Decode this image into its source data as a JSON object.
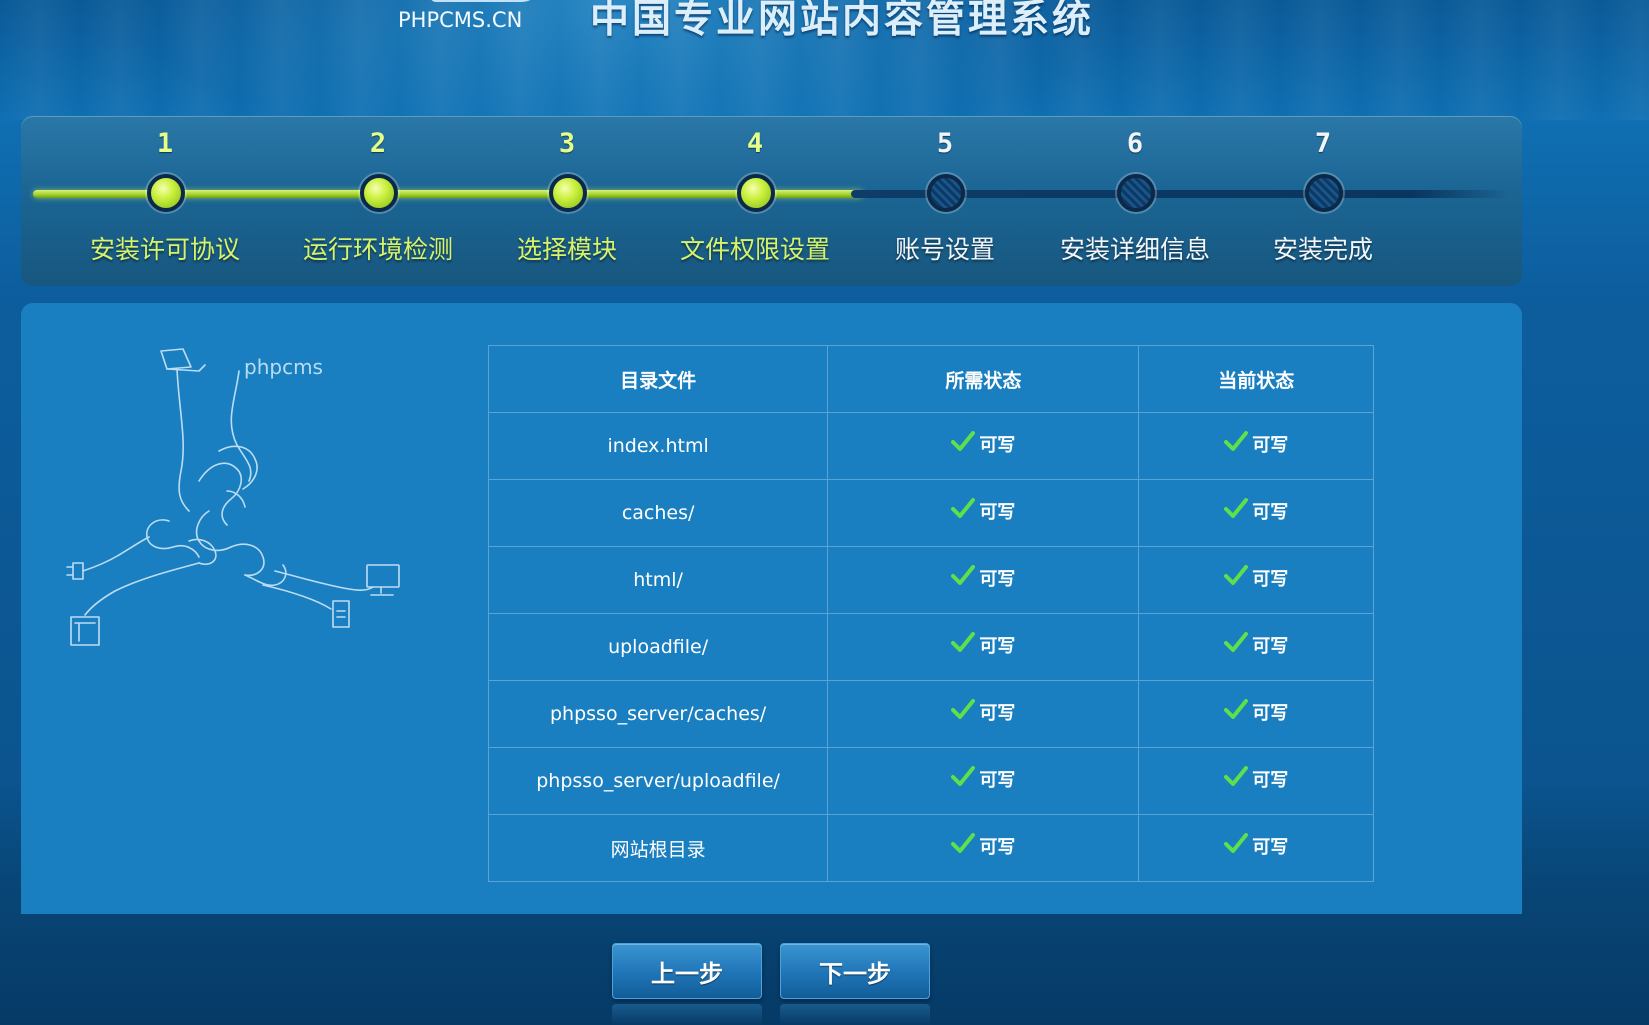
{
  "header": {
    "logo_text": "PHPCMS.CN",
    "title": "中国专业网站内容管理系统"
  },
  "steps": [
    {
      "num": "1",
      "label": "安装许可协议",
      "status": "done"
    },
    {
      "num": "2",
      "label": "运行环境检测",
      "status": "done"
    },
    {
      "num": "3",
      "label": "选择模块",
      "status": "done"
    },
    {
      "num": "4",
      "label": "文件权限设置",
      "status": "current"
    },
    {
      "num": "5",
      "label": "账号设置",
      "status": "todo"
    },
    {
      "num": "6",
      "label": "安装详细信息",
      "status": "todo"
    },
    {
      "num": "7",
      "label": "安装完成",
      "status": "todo"
    }
  ],
  "illustration": {
    "caption": "phpcms"
  },
  "permissions_table": {
    "headers": [
      "目录文件",
      "所需状态",
      "当前状态"
    ],
    "rows": [
      {
        "path": "index.html",
        "required": "可写",
        "current": "可写"
      },
      {
        "path": "caches/",
        "required": "可写",
        "current": "可写"
      },
      {
        "path": "html/",
        "required": "可写",
        "current": "可写"
      },
      {
        "path": "uploadfile/",
        "required": "可写",
        "current": "可写"
      },
      {
        "path": "phpsso_server/caches/",
        "required": "可写",
        "current": "可写"
      },
      {
        "path": "phpsso_server/uploadfile/",
        "required": "可写",
        "current": "可写"
      },
      {
        "path": "网站根目录",
        "required": "可写",
        "current": "可写"
      }
    ]
  },
  "buttons": {
    "prev_label": "上一步",
    "next_label": "下一步"
  },
  "colors": {
    "done_step": "#c9f03c",
    "todo_step": "#0c3a66",
    "panel": "#1a7fc0",
    "check": "#5fe04a"
  }
}
